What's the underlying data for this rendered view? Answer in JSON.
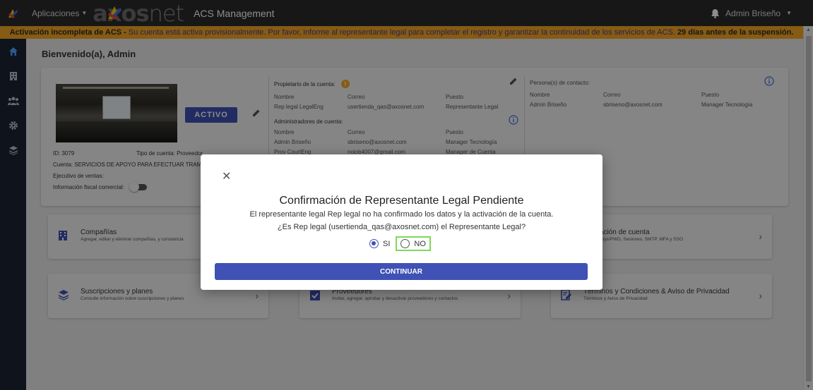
{
  "topbar": {
    "apps_label": "Aplicaciones",
    "brand_bold": "axos",
    "brand_light": "net",
    "title": "ACS Management",
    "user_name": "Admin Briseño"
  },
  "banner": {
    "lead": "Activación incompleta de ACS -",
    "message": "Su cuenta está activa provisionalmente. Por favor, informe al representante legal para completar el registro y garantizar la continuidad de los servicios de ACS.",
    "days": "29 días antes de la suspensión."
  },
  "main": {
    "welcome": "Bienvenido(a), Admin",
    "account": {
      "status": "ACTIVO",
      "id": "ID: 3079",
      "tipo_label": "Tipo de cuenta:",
      "tipo_value": "Proveedor",
      "cuenta_label": "Cuenta:",
      "cuenta_value": "SERVICIOS DE APOYO PARA EFECTUAR TRAM",
      "ejecutivo_label": "Ejecutivo de ventas:",
      "fiscal_label": "Información fiscal comercial:"
    },
    "owner": {
      "heading": "Propietario de la cuenta:",
      "headers": [
        "Nombre",
        "Correo",
        "Puesto"
      ],
      "row": [
        "Rep legal LegalEng",
        "usertienda_qas@axosnet.com",
        "Representante Legal"
      ]
    },
    "admins": {
      "heading": "Administradores de cuenta:",
      "headers": [
        "Nombre",
        "Correo",
        "Puesto"
      ],
      "rows": [
        [
          "Admin Briseño",
          "sbriseno@axosnet.com",
          "Manager Tecnología"
        ],
        [
          "Prov CourtEng",
          "noiob4007@gmail.com",
          "Manager de Cuenta"
        ]
      ]
    },
    "contacts": {
      "heading": "Persona(s) de contacto:",
      "headers": [
        "Nombre",
        "Correo",
        "Puesto"
      ],
      "row": [
        "Admin Briseño",
        "sbriseno@axosnet.com",
        "Manager Tecnología"
      ]
    },
    "tiles": [
      {
        "title": "Compañías",
        "sub": "Agregar, editar y eliminar compañías, y constancia"
      },
      {
        "title": "uración de cuenta",
        "sub": "d, Keys/PWD, Sesiones, SMTP, MFA y SSO"
      },
      {
        "title": "Suscripciones y planes",
        "sub": "Consulte información sobre suscripciones y planes"
      },
      {
        "title": "Proveedores",
        "sub": "Invitar, agregar, aprobar y desactivar proveedores y contactos"
      },
      {
        "title": "Términos y Condiciones & Aviso de Privacidad",
        "sub": "Términos y Aviso de Privacidad"
      }
    ]
  },
  "modal": {
    "title": "Confirmación de Representante Legal Pendiente",
    "line1": "El representante legal Rep legal no ha confirmado los datos y la activación de la cuenta.",
    "line2": "¿Es Rep legal (usertienda_qas@axosnet.com) el Representante Legal?",
    "option_yes": "SI",
    "option_no": "NO",
    "selected": "SI",
    "continue_label": "CONTINUAR"
  },
  "colors": {
    "primary": "#3f51b5",
    "banner": "#f5a623",
    "sidebar": "#1b2333",
    "topbar": "#2a2a2a",
    "highlight": "#7ed957"
  }
}
